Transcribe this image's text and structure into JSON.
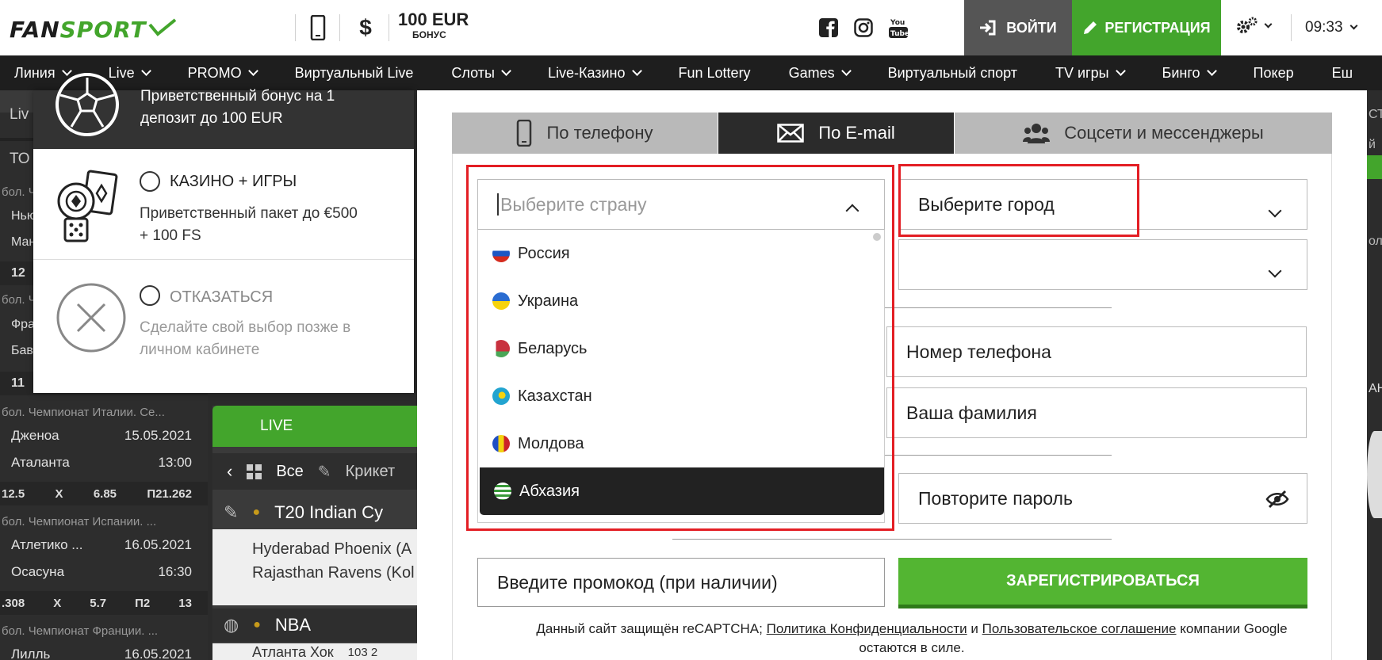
{
  "header": {
    "logo_part1": "FAN",
    "logo_part2": "SPORT",
    "bonus_amount": "100 EUR",
    "bonus_label": "БОНУС",
    "login_label": "ВОЙТИ",
    "register_label": "РЕГИСТРАЦИЯ",
    "time": "09:33",
    "currency_symbol": "$"
  },
  "nav": {
    "items": [
      {
        "label": "Линия",
        "dropdown": true
      },
      {
        "label": "Live",
        "dropdown": true
      },
      {
        "label": "PROMO",
        "dropdown": true
      },
      {
        "label": "Виртуальный Live",
        "dropdown": false
      },
      {
        "label": "Слоты",
        "dropdown": true
      },
      {
        "label": "Live-Казино",
        "dropdown": true
      },
      {
        "label": "Fun Lottery",
        "dropdown": false
      },
      {
        "label": "Games",
        "dropdown": true
      },
      {
        "label": "Виртуальный спорт",
        "dropdown": false
      },
      {
        "label": "TV игры",
        "dropdown": true
      },
      {
        "label": "Бинго",
        "dropdown": true
      },
      {
        "label": "Покер",
        "dropdown": false
      },
      {
        "label": "Еш",
        "dropdown": false
      }
    ]
  },
  "bonus_panel": {
    "sport_desc_line1": "Приветственный бонус на 1",
    "sport_desc_line2": "депозит до 100 EUR",
    "casino_title": "КАЗИНО + ИГРЫ",
    "casino_desc_line1": "Приветственный пакет до €500",
    "casino_desc_line2": "+ 100 FS",
    "decline_title": "ОТКАЗАТЬСЯ",
    "decline_desc_line1": "Сделайте свой выбор позже в",
    "decline_desc_line2": "личном кабинете"
  },
  "background": {
    "left_fragments": [
      "Liv",
      "ТО",
      "бол. Ч",
      "Нью",
      "Ман",
      "12",
      "бол. Ч",
      "Фра",
      "Бав",
      "11"
    ],
    "matches": [
      {
        "league": "бол. Чемпионат Италии. Се...",
        "team1": "Дженоа",
        "date": "15.05.2021",
        "team2": "Аталанта",
        "time": "13:00",
        "odds": [
          "12.5",
          "X",
          "6.85",
          "П21.262"
        ]
      },
      {
        "league": "бол. Чемпионат Испании. ...",
        "team1": "Атлетико ...",
        "date": "16.05.2021",
        "team2": "Осасуна",
        "time": "16:30",
        "odds": [
          ".308",
          "X",
          "5.7",
          "П2",
          "13"
        ]
      },
      {
        "league": "бол. Чемпионат Франции. ...",
        "team1": "Лилль",
        "date": "16.05.2021"
      }
    ],
    "live_label": "LIVE",
    "filter_all": "Все",
    "filter_cricket": "Крикет",
    "live_event1": "T20 Indian Cу",
    "live_team1": "Hyderabad Phoenix (А",
    "live_team2": "Rajasthan Ravens (Kol",
    "live_event2": "NBA",
    "live_event3": "Атланта Хок",
    "live_score": "103  2",
    "right_fragments": [
      "СТ",
      "й",
      "ол",
      "АН"
    ]
  },
  "registration": {
    "tabs": [
      {
        "label": "По телефону",
        "active": false
      },
      {
        "label": "По E-mail",
        "active": true
      },
      {
        "label": "Соцсети и мессенджеры",
        "active": false
      }
    ],
    "country_placeholder": "Выберите страну",
    "city_placeholder": "Выберите город",
    "phone_placeholder": "Номер телефона",
    "surname_placeholder": "Ваша фамилия",
    "repeat_password_placeholder": "Повторите пароль",
    "promo_placeholder": "Введите промокод (при наличии)",
    "submit_label": "ЗАРЕГИСТРИРОВАТЬСЯ",
    "countries": [
      {
        "name": "Россия",
        "selected": false
      },
      {
        "name": "Украина",
        "selected": false
      },
      {
        "name": "Беларусь",
        "selected": false
      },
      {
        "name": "Казахстан",
        "selected": false
      },
      {
        "name": "Молдова",
        "selected": false
      },
      {
        "name": "Абхазия",
        "selected": true
      }
    ],
    "captcha_text_1": "Данный сайт защищён reCAPTCHA;",
    "captcha_link_privacy": "Политика Конфиденциальности",
    "captcha_and": "и",
    "captcha_link_terms": "Пользовательское соглашение",
    "captcha_text_2": "компании Google",
    "captcha_text_3": "остаются в силе."
  },
  "colors": {
    "brand_green": "#43a52c",
    "highlight_red": "#e31e24",
    "dark": "#1e1e1e"
  }
}
